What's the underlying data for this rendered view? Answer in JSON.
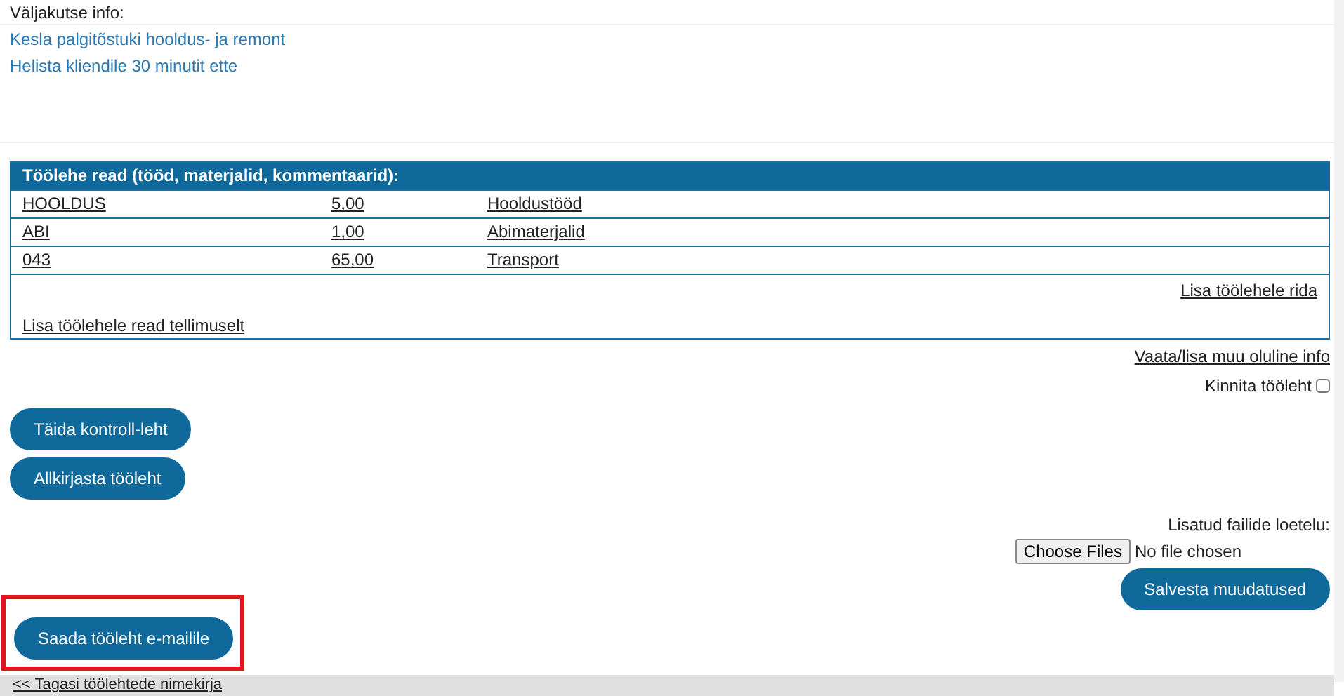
{
  "callout_info": {
    "label": "Väljakutse info:",
    "lines": [
      "Kesla palgitõstuki hooldus- ja remont",
      "Helista kliendile 30 minutit ette"
    ]
  },
  "worksheet_rows": {
    "title": "Töölehe read (tööd, materjalid, kommentaarid):",
    "rows": [
      {
        "code": "HOOLDUS",
        "quantity": "5,00",
        "description": "Hooldustööd"
      },
      {
        "code": "ABI",
        "quantity": "1,00",
        "description": "Abimaterjalid"
      },
      {
        "code": "043",
        "quantity": "65,00",
        "description": "Transport"
      }
    ],
    "add_row_link": "Lisa töölehele rida",
    "add_from_order_link": "Lisa töölehele read tellimuselt"
  },
  "other_info_link": "Vaata/lisa muu oluline info",
  "confirm": {
    "label": "Kinnita tööleht",
    "checked": false
  },
  "action_buttons": [
    {
      "label": "Täida kontroll-leht",
      "highlighted": false
    },
    {
      "label": "Allkirjasta tööleht",
      "highlighted": false
    }
  ],
  "attachments": {
    "label": "Lisatud failide loetelu:",
    "choose_button": "Choose Files",
    "status": "No file chosen",
    "save_button": "Salvesta muudatused"
  },
  "email_button": {
    "label": "Saada tööleht e-mailile",
    "highlighted": true
  },
  "footer": {
    "back_link": "<< Tagasi töölehtede nimekirja"
  }
}
